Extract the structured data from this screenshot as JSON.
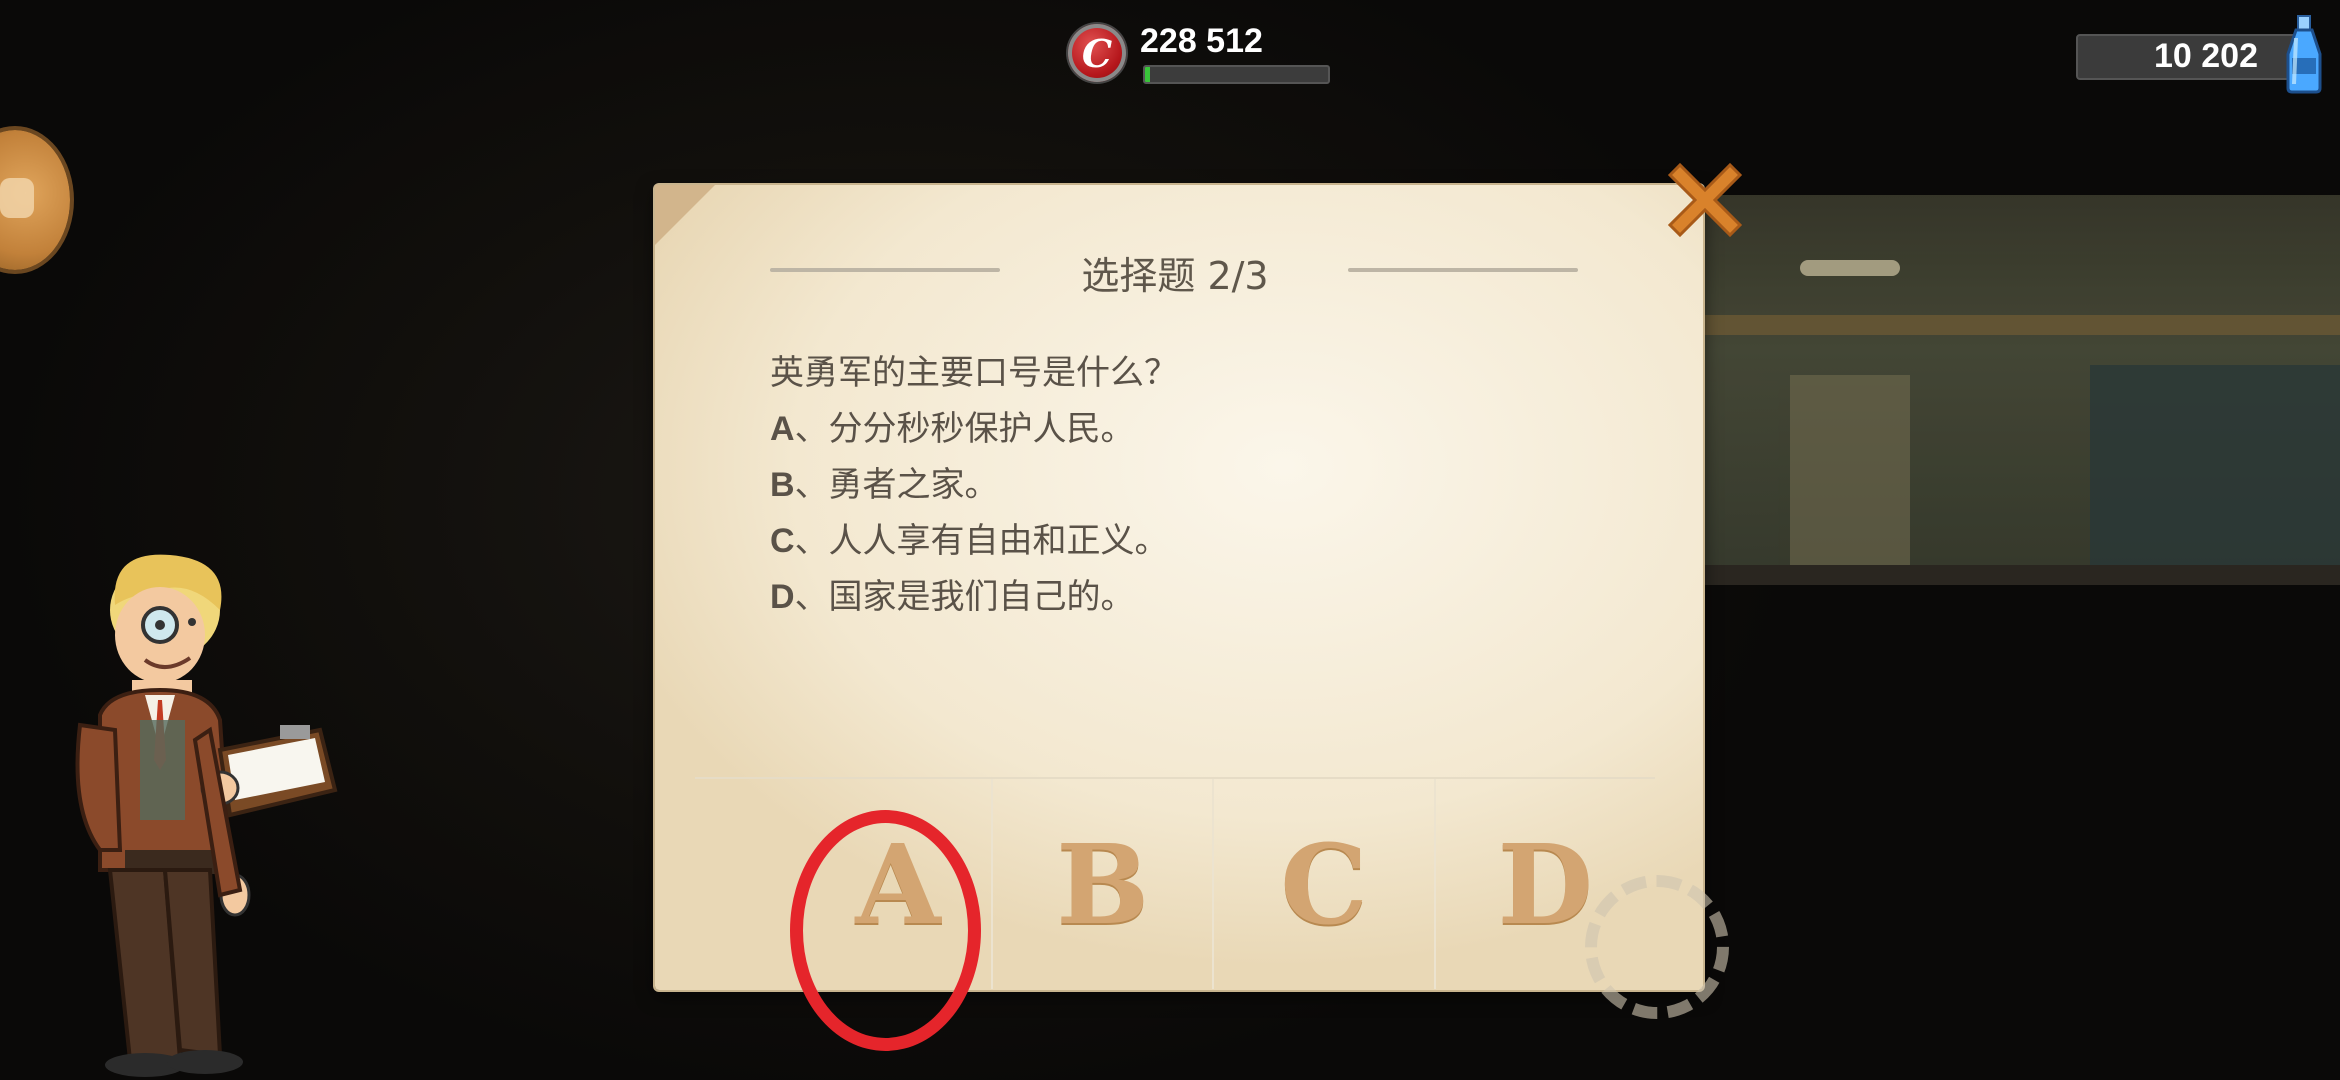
{
  "hud": {
    "caps_value": "228 512",
    "xp_progress": 0.03,
    "nuka_quantum_value": "10 202"
  },
  "dialog": {
    "title": "选择题 2/3",
    "question": "英勇军的主要口号是什么？",
    "options": [
      {
        "letter": "A",
        "text": "、分分秒秒保护人民。"
      },
      {
        "letter": "B",
        "text": "、勇者之家。"
      },
      {
        "letter": "C",
        "text": "、人人享有自由和正义。"
      },
      {
        "letter": "D",
        "text": "、国家是我们自己的。"
      }
    ],
    "answers": [
      "A",
      "B",
      "C",
      "D"
    ]
  },
  "icons": {
    "caps": "bottle-cap-icon",
    "nuka": "nuka-quantum-icon",
    "close": "close-x-icon",
    "side": "gamepad-icon"
  },
  "colors": {
    "paper": "#f3e8d0",
    "answer_letter": "#d3a572",
    "close": "#d9822b",
    "highlight_ring": "#e5252b",
    "xp_fill": "#39c43a"
  }
}
